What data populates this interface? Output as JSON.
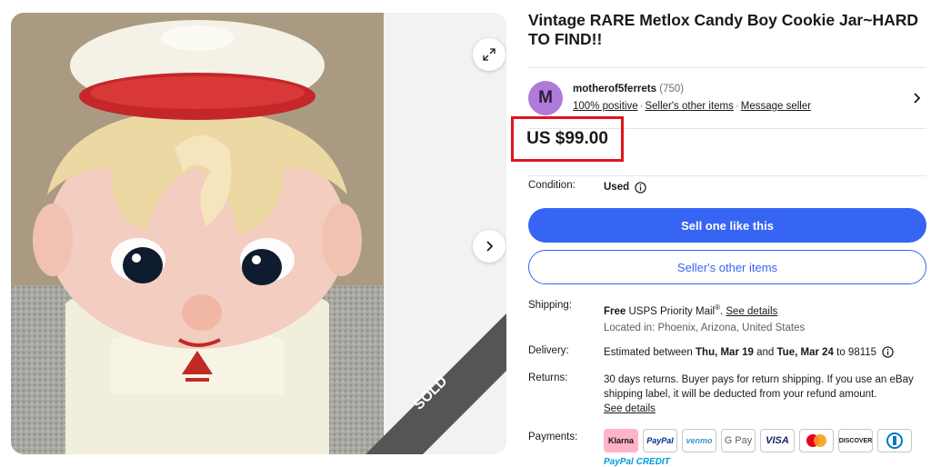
{
  "gallery": {
    "sold_label": "SOLD",
    "expand_icon": "expand-icon",
    "next_icon": "chevron-right-icon"
  },
  "listing": {
    "title": "Vintage RARE Metlox Candy Boy Cookie Jar~HARD TO FIND!!"
  },
  "seller": {
    "avatar_letter": "M",
    "name": "motherof5ferrets",
    "feedback_count": "(750)",
    "positive": "100% positive",
    "other_items": "Seller's other items",
    "message": "Message seller"
  },
  "price": "US $99.00",
  "condition": {
    "label": "Condition:",
    "value": "Used"
  },
  "buttons": {
    "sell_like": "Sell one like this",
    "sellers_items": "Seller's other items"
  },
  "shipping": {
    "label": "Shipping:",
    "free": "Free",
    "method": "USPS Priority Mail",
    "reg": "®",
    "details": "See details",
    "location": "Located in: Phoenix, Arizona, United States"
  },
  "delivery": {
    "label": "Delivery:",
    "prefix": "Estimated between",
    "start": "Thu, Mar 19",
    "and": "and",
    "end": "Tue, Mar 24",
    "to": "to 98115"
  },
  "returns": {
    "label": "Returns:",
    "text": "30 days returns. Buyer pays for return shipping. If you use an eBay shipping label, it will be deducted from your refund amount.",
    "details": "See details"
  },
  "payments": {
    "label": "Payments:",
    "methods": [
      "Klarna",
      "PayPal",
      "venmo",
      "G Pay",
      "VISA",
      "Mastercard",
      "DISCOVER",
      "Diners"
    ],
    "paypal_credit_a": "PayPal",
    "paypal_credit_b": "CREDIT"
  },
  "colors": {
    "primary": "#3665f3",
    "highlight_border": "#e0141e"
  }
}
